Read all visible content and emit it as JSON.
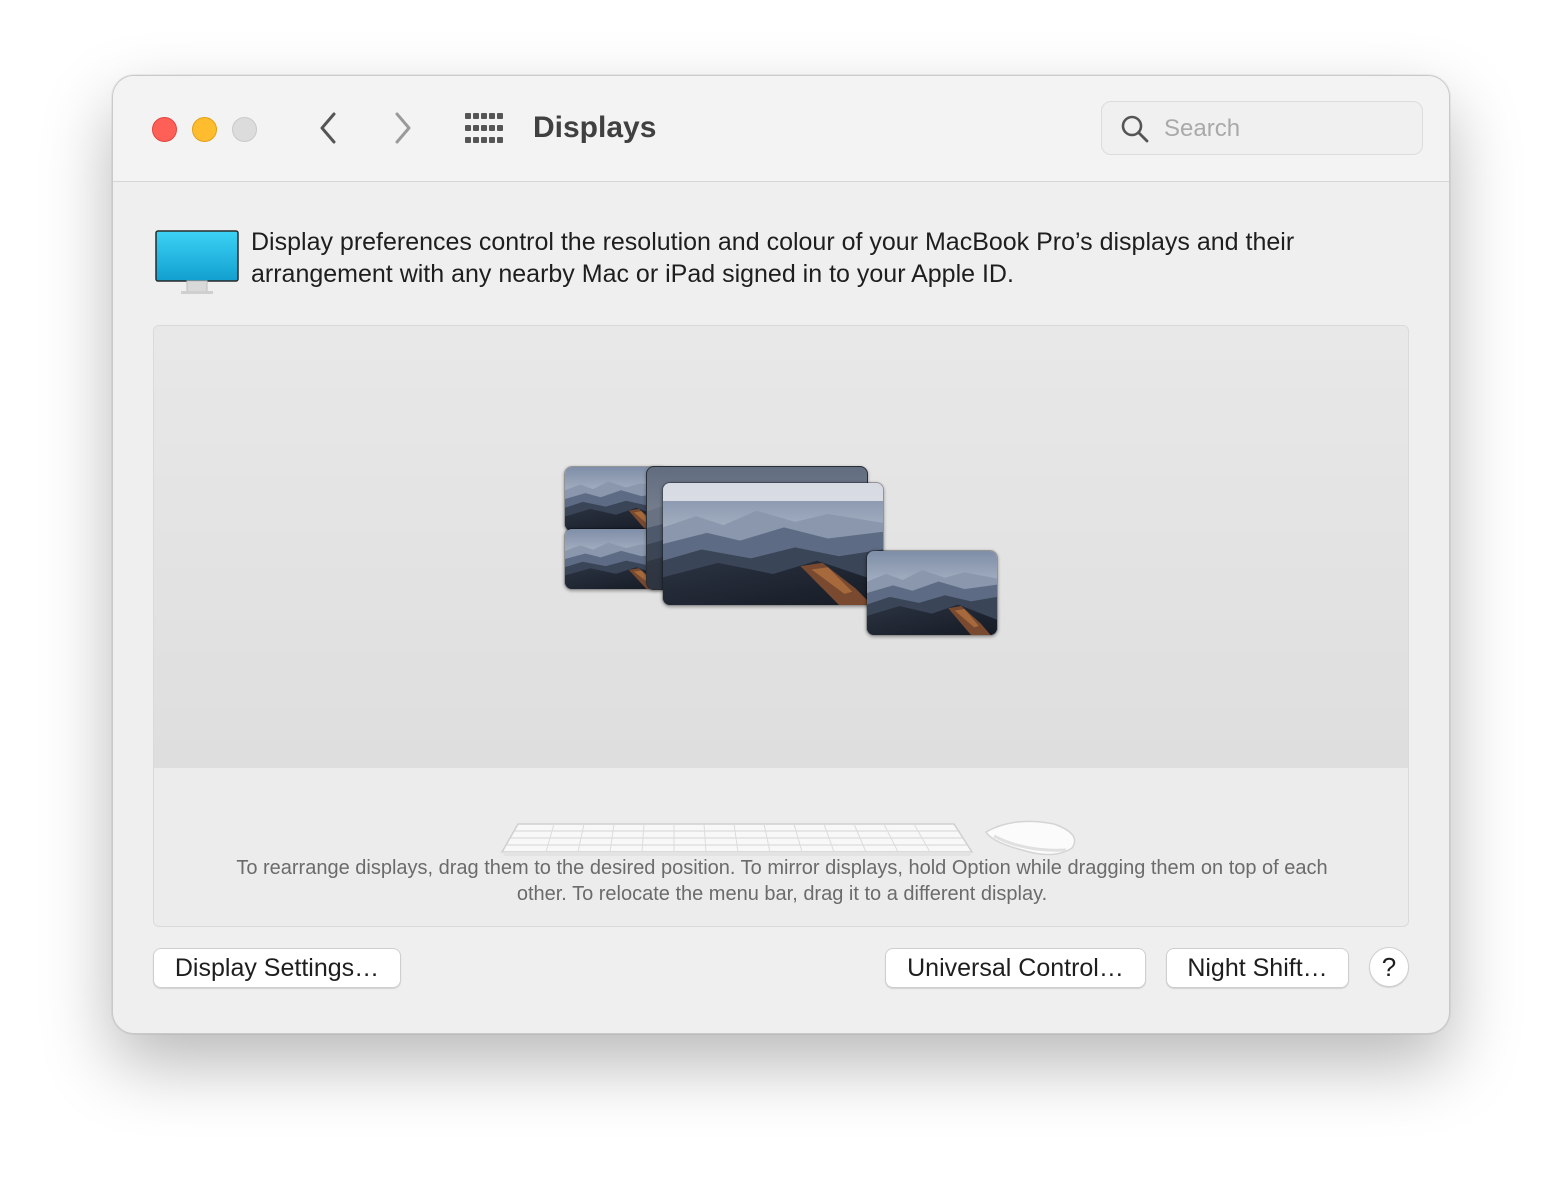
{
  "window": {
    "title": "Displays"
  },
  "toolbar": {
    "back_icon": "chevron-left-icon",
    "forward_icon": "chevron-right-icon",
    "grid_icon": "show-all-grid-icon"
  },
  "search": {
    "placeholder": "Search",
    "value": ""
  },
  "intro": {
    "text": "Display preferences control the resolution and colour of your MacBook Pro’s displays and their arrangement with any nearby Mac or iPad signed in to your Apple ID."
  },
  "arrangement": {
    "instructions": "To rearrange displays, drag them to the desired position. To mirror displays, hold Option while dragging them on top of each other. To relocate the menu bar, drag it to a different display."
  },
  "buttons": {
    "display_settings": "Display Settings…",
    "universal_control": "Universal Control…",
    "night_shift": "Night Shift…",
    "help": "?"
  },
  "colors": {
    "close": "#fe5f57",
    "minimize": "#febc2e",
    "zoom_disabled": "#dcdcdc",
    "display_icon_screen": "#1fb6e0"
  }
}
